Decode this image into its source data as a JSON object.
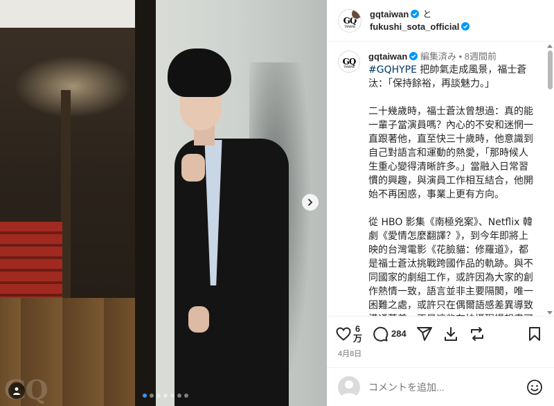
{
  "post": {
    "author": "gqtaiwan",
    "collab_joiner": "と",
    "collaborator": "fukushi_sota_official",
    "avatar_logo": "GQ",
    "avatar_sub": "TAIWAN",
    "watermark": "GQ"
  },
  "caption": {
    "username": "gqtaiwan",
    "edited": "編集済み",
    "separator": "•",
    "time_ago": "8週間前",
    "hashtag": "#GQHYPE",
    "text_first": " 把帥氣走成風景，福士蒼汰：「保持餘裕，再談魅力。」",
    "text_rest": "\n\n二十幾歲時，福士蒼汰曾想過：真的能一輩子當演員嗎？內心的不安和迷惘一直跟著他，直至快三十歲時，他意識到自己對語言和運動的熱愛，「那時候人生重心變得清晰許多。」當融入日常習慣的興趣，與演員工作相互結合，他開始不再困惑，事業上更有方向。\n\n從 HBO 影集《南極兇案》、Netflix 韓劇《愛情怎麼翻譯？》，到今年即將上映的台灣電影《花臉貓：修羅道》，都是福士蒼汰挑戰跨國作品的軌跡。與不同國家的劇組工作，或許因為大家的創作熱情一致，語言並非主要隔閡，唯一困難之處，或許只在偶爾語感差異導致溝通落差。正是這些在拍攝現場想盡可能融入當地語境的想法，讓他回頭看見自己對語言的興趣，更意識到內心存在一股向"
  },
  "actions": {
    "like_count_top": "6",
    "like_count_bottom": "万",
    "comment_count": "284",
    "icons": [
      "heart-icon",
      "comment-icon",
      "share-icon",
      "download-icon",
      "repost-icon",
      "bookmark-icon"
    ]
  },
  "date": "4月8日",
  "comment": {
    "placeholder": "コメントを追加..."
  },
  "carousel": {
    "slides": 7,
    "active_index": 0
  },
  "colors": {
    "verified": "#0095f6",
    "hashtag": "#00376b",
    "muted": "#737373",
    "active_dot": "#3897f0"
  }
}
